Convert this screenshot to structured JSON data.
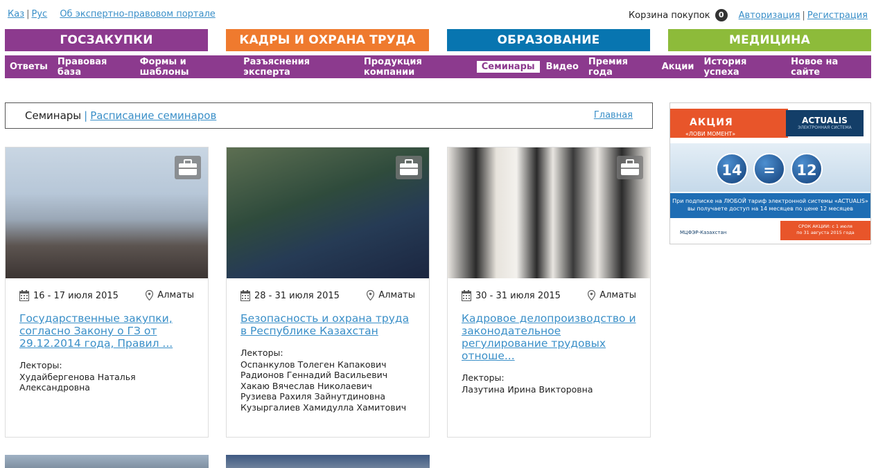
{
  "top": {
    "lang_kaz": "Каз",
    "lang_rus": "Рус",
    "about": "Об экспертно-правовом портале",
    "cart_label": "Корзина покупок",
    "cart_count": "0",
    "login": "Авторизация",
    "register": "Регистрация"
  },
  "categories": [
    "ГОСЗАКУПКИ",
    "КАДРЫ И ОХРАНА ТРУДА",
    "ОБРАЗОВАНИЕ",
    "МЕДИЦИНА"
  ],
  "category_colors": [
    "#8c3a8e",
    "#ef7a2e",
    "#0875b0",
    "#8dbb3a"
  ],
  "nav": [
    "Ответы",
    "Правовая база",
    "Формы и шаблоны",
    "Разъяснения эксперта",
    "Продукция компании",
    "Семинары",
    "Видео",
    "Премия года",
    "Акции",
    "История успеха",
    "Новое на сайте"
  ],
  "nav_active": "Семинары",
  "breadcrumb": {
    "current": "Семинары",
    "link": "Расписание семинаров",
    "home": "Главная"
  },
  "cards": [
    {
      "date": "16 - 17 июля 2015",
      "place": "Алматы",
      "title": "Государственные закупки, согласно Закону о ГЗ от 29.12.2014 года, Правил ...",
      "lecturers_label": "Лекторы:",
      "lecturers": [
        "Худайбергенова Наталья Александровна"
      ]
    },
    {
      "date": "28 - 31 июля 2015",
      "place": "Алматы",
      "title": "Безопасность и охрана труда в Республике Казахстан",
      "lecturers_label": "Лекторы:",
      "lecturers": [
        "Оспанкулов Толеген Капакович",
        "Радионов Геннадий Васильевич",
        "Хакаю Вячеслав Николаевич",
        "Рузиева Рахиля Зайнутдиновна",
        "Кузыргалиев Хамидулла Хамитович"
      ]
    },
    {
      "date": "30 - 31 июля 2015",
      "place": "Алматы",
      "title": "Кадровое делопроизводство и законодательное регулирование трудовых отноше...",
      "lecturers_label": "Лекторы:",
      "lecturers": [
        "Лазутина Ирина Викторовна"
      ]
    }
  ],
  "ad": {
    "banner_title": "АКЦИЯ",
    "banner_sub": "«ЛОВИ МОМЕНТ»",
    "brand": "ACTUALIS",
    "brand_sub": "ЭЛЕКТРОННАЯ СИСТЕМА",
    "num_a": "14",
    "num_eq": "=",
    "num_b": "12",
    "text_1": "При подписке на ЛЮБОЙ тариф электронной системы «ACTUALIS»",
    "text_2": "вы получаете доступ на 14 месяцев по цене 12 месяцев",
    "footer_logo": "МЦФЭР-Казахстан",
    "promo_1": "СРОК АКЦИИ: с 1 июля",
    "promo_2": "по 31 августа 2015 года"
  }
}
